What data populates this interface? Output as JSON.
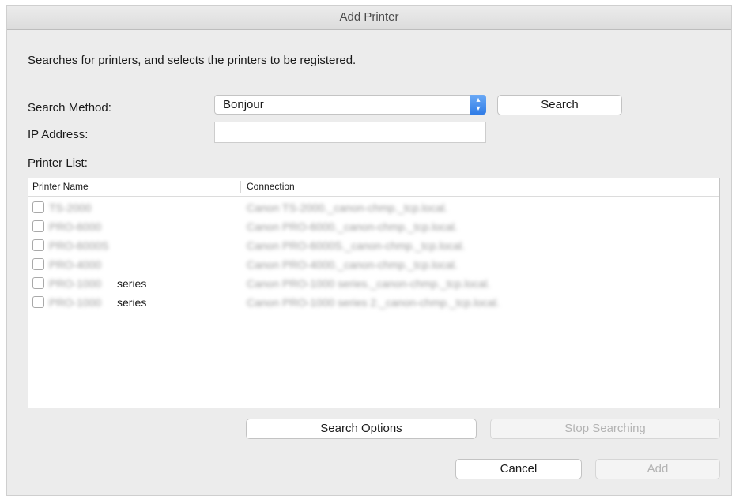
{
  "window": {
    "title": "Add Printer"
  },
  "description": "Searches for printers, and selects the printers to be registered.",
  "search_method": {
    "label": "Search Method:",
    "selected": "Bonjour"
  },
  "search_button": "Search",
  "ip_address": {
    "label": "IP Address:",
    "value": ""
  },
  "printer_list": {
    "label": "Printer List:",
    "columns": {
      "name": "Printer Name",
      "connection": "Connection"
    },
    "rows": [
      {
        "name": "TS-2000",
        "suffix": "",
        "connection": "Canon TS-2000._canon-chmp._tcp.local."
      },
      {
        "name": "PRO-6000",
        "suffix": "",
        "connection": "Canon PRO-6000._canon-chmp._tcp.local."
      },
      {
        "name": "PRO-6000S",
        "suffix": "",
        "connection": "Canon PRO-6000S._canon-chmp._tcp.local."
      },
      {
        "name": "PRO-4000",
        "suffix": "",
        "connection": "Canon PRO-4000._canon-chmp._tcp.local."
      },
      {
        "name": "PRO-1000",
        "suffix": "series",
        "connection": "Canon PRO-1000 series._canon-chmp._tcp.local."
      },
      {
        "name": "PRO-1000",
        "suffix": "series",
        "connection": "Canon PRO-1000 series 2._canon-chmp._tcp.local."
      }
    ]
  },
  "buttons": {
    "search_options": "Search Options",
    "stop_searching": "Stop Searching",
    "cancel": "Cancel",
    "add": "Add"
  }
}
